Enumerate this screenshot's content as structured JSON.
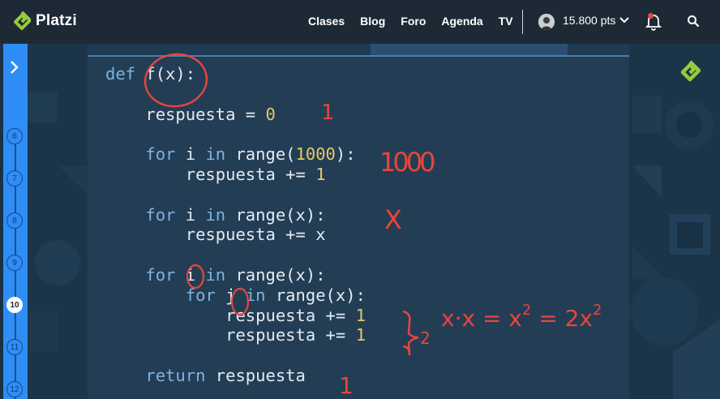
{
  "brand": {
    "name": "Platzi",
    "color": "#98ca3f"
  },
  "nav": {
    "links": [
      "Clases",
      "Blog",
      "Foro",
      "Agenda",
      "TV"
    ],
    "points": "15.800 pts"
  },
  "sidebar": {
    "steps": [
      "6",
      "7",
      "8",
      "9",
      "10",
      "11",
      "12"
    ],
    "active_step": "10"
  },
  "code": {
    "def": "def",
    "signature": " f(x):",
    "l_init": "respuesta = ",
    "zero": "0",
    "for": "for",
    "in": "in",
    "i": " i ",
    "j": " j ",
    "range_1000_a": " range(",
    "n1000": "1000",
    "range_1000_b": "):",
    "plus_one": "respuesta += ",
    "one": "1",
    "range_x": " range(x):",
    "plus_x": "respuesta += x",
    "return": "return",
    "ret_var": " respuesta"
  },
  "annotations": {
    "mark_1": "1",
    "mark_1000": "1000",
    "mark_x": "X",
    "mark_2": "2",
    "mark_formula": "x·x = x",
    "mark_formula_end": " = 2x",
    "exp": "2",
    "mark_return": "1",
    "ink_color": "#e8453c"
  },
  "colors": {
    "sidebar": "#2f8df6",
    "nav_bg": "#1d2a36",
    "slide_bg": "#233d55",
    "keyword": "#7fb3e0",
    "number": "#e3c96a"
  }
}
